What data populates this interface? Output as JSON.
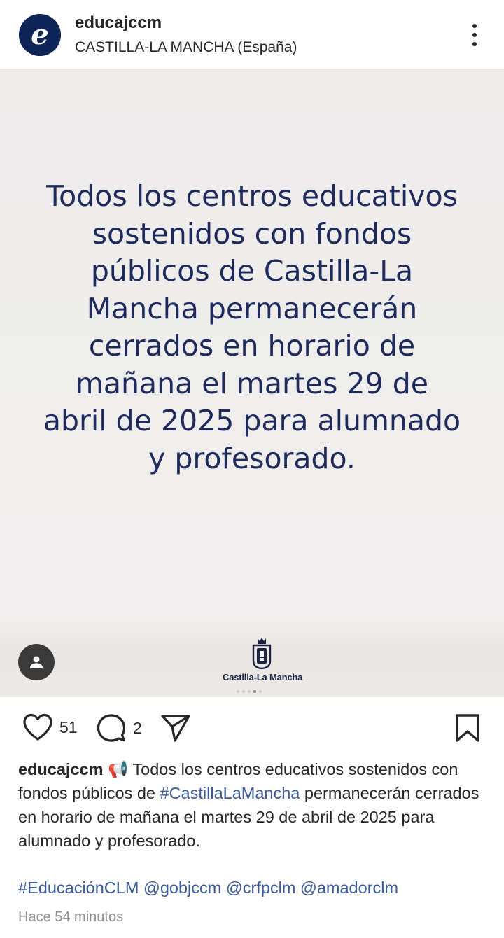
{
  "header": {
    "username": "educajccm",
    "location": "CASTILLA-LA MANCHA (España)",
    "avatar_icon": "educa-e-logo",
    "more_icon": "more-vertical-icon"
  },
  "post": {
    "image_text": "Todos los centros educativos sostenidos con fondos públicos de Castilla-La Mancha permanecerán cerrados en horario de mañana el martes 29 de abril de 2025 para alumnado y profesorado.",
    "logo_text": "Castilla-La Mancha",
    "text_color": "#1f2a5c",
    "carousel_dots": 5,
    "active_dot": 3
  },
  "actions": {
    "likes": "51",
    "comments": "2"
  },
  "caption": {
    "username": "educajccm",
    "emoji": "📢",
    "part1": " Todos los centros educativos sostenidos con fondos públicos de ",
    "hashtag1": "#CastillaLaMancha",
    "part2": " permanecerán cerrados en horario de mañana el martes 29 de abril de 2025 para alumnado y profesorado."
  },
  "tags": {
    "hashtag": "#EducaciónCLM",
    "mention1": "@gobjccm",
    "mention2": "@crfpclm",
    "mention3": "@amadorclm"
  },
  "timestamp": "Hace 54 minutos",
  "colors": {
    "link": "#3a5a9b",
    "brand": "#0f2557"
  }
}
